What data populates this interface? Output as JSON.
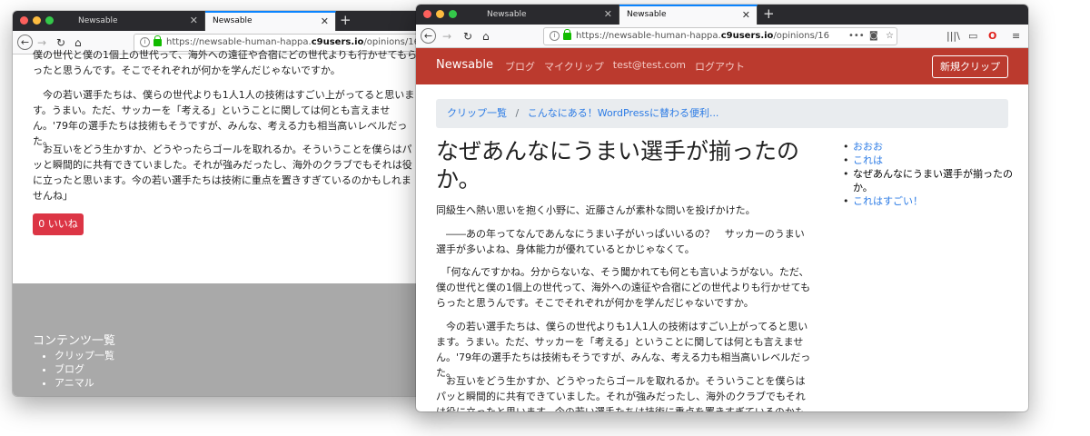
{
  "back_window": {
    "tabs": [
      {
        "label": "Newsable"
      },
      {
        "label": "Newsable"
      }
    ],
    "url_prefix": "https://newsable-human-happa.",
    "url_domain": "c9users.io",
    "url_path": "/opinions/16",
    "paragraphs": [
      "僕の世代と僕の1個上の世代って、海外への遠征や合宿にどの世代よりも行かせてもらったと思うんです。そこでそれぞれが何かを学んだじゃないですか。",
      "　今の若い選手たちは、僕らの世代よりも1人1人の技術はすごい上がってると思います。うまい。ただ、サッカーを「考える」ということに関しては何とも言えません。'79年の選手たちは技術もそうですが、みんな、考える力も相当高いレベルだった。",
      "　お互いをどう生かすか、どうやったらゴールを取れるか。そういうことを僕らはパッと瞬間的に共有できていました。それが強みだったし、海外のクラブでもそれは役に立ったと思います。今の若い選手たちは技術に重点を置きすぎているのかもしれませんね」"
    ],
    "like_label": "0 いいね",
    "footer_title": "コンテンツ一覧",
    "footer_items": [
      "クリップ一覧",
      "ブログ",
      "アニマル"
    ]
  },
  "front_window": {
    "tabs": [
      {
        "label": "Newsable"
      },
      {
        "label": "Newsable"
      }
    ],
    "url_prefix": "https://newsable-human-happa.",
    "url_domain": "c9users.io",
    "url_path": "/opinions/16",
    "brand": "Newsable",
    "nav": [
      "ブログ",
      "マイクリップ",
      "test@test.com",
      "ログアウト"
    ],
    "new_clip": "新規クリップ",
    "breadcrumb": {
      "first": "クリップ一覧",
      "sep": "/",
      "second": "こんなにある！WordPressに替わる便利..."
    },
    "title": "なぜあんなにうまい選手が揃ったのか。",
    "paragraphs": [
      "同級生へ熱い思いを抱く小野に、近藤さんが素朴な問いを投げかけた。",
      "　――あの年ってなんであんなにうまい子がいっぱいいるの？　サッカーのうまい選手が多いよね、身体能力が優れているとかじゃなくて。",
      "　「何なんですかね。分からないな、そう聞かれても何とも言いようがない。ただ、僕の世代と僕の1個上の世代って、海外への遠征や合宿にどの世代よりも行かせてもらったと思うんです。そこでそれぞれが何かを学んだじゃないですか。",
      "　今の若い選手たちは、僕らの世代よりも1人1人の技術はすごい上がってると思います。うまい。ただ、サッカーを「考える」ということに関しては何とも言えません。'79年の選手たちは技術もそうですが、みんな、考える力も相当高いレベルだった。",
      "　お互いをどう生かすか、どうやったらゴールを取れるか。そういうことを僕らはパッと瞬間的に共有できていました。それが強みだったし、海外のクラブでもそれは役に立ったと思います。今の若い選手たちは技術に重点を置きすぎているのかもしれ"
    ],
    "sidebar": [
      {
        "label": "おおお",
        "link": true
      },
      {
        "label": "これは",
        "link": true
      },
      {
        "label": "なぜあんなにうまい選手が揃ったのか。",
        "link": false
      },
      {
        "label": "これはすごい！",
        "link": true
      }
    ]
  }
}
